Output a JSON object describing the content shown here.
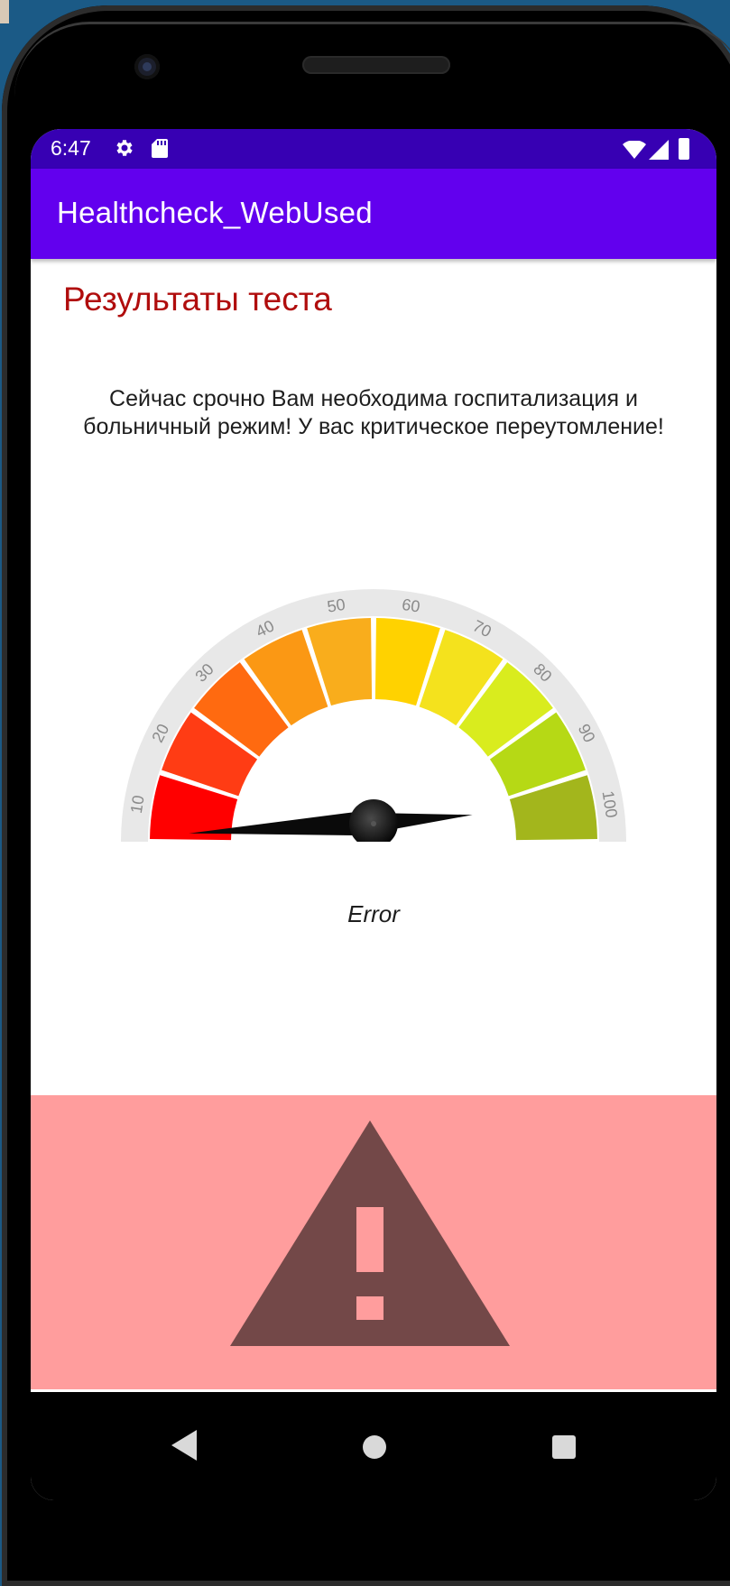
{
  "status_bar": {
    "time": "6:47",
    "icons": [
      "gear-icon",
      "sd-card-icon",
      "wifi-icon",
      "signal-icon",
      "battery-icon"
    ]
  },
  "app_bar": {
    "title": "Healthcheck_WebUsed"
  },
  "content": {
    "result_title": "Результаты теста",
    "message": "Сейчас срочно Вам необходима госпитализация и больничный режим! У вас критическое переутомление!",
    "gauge": {
      "ticks": [
        "10",
        "20",
        "30",
        "40",
        "50",
        "60",
        "70",
        "80",
        "90",
        "100"
      ],
      "segment_colors": [
        "#ff0000",
        "#ff3c14",
        "#ff6a10",
        "#fb9814",
        "#f9ad1c",
        "#ffd200",
        "#f4e21d",
        "#d9ec1e",
        "#b6d915",
        "#a3b61c"
      ],
      "needle_value": 0,
      "label": "Error"
    }
  },
  "warning": {
    "icon": "warning-icon",
    "background": "#ff9d9d",
    "icon_color": "#734848"
  },
  "nav_bar": {
    "items": [
      "back-icon",
      "home-icon",
      "recents-icon"
    ]
  }
}
